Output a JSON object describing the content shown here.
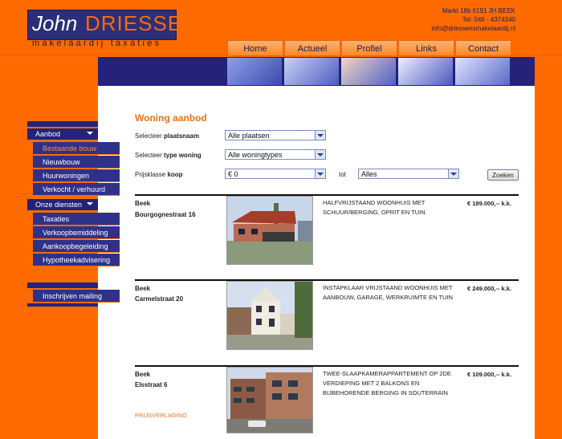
{
  "logo": {
    "first": "John",
    "last": "DRIESSENS",
    "tagline": "makelaardij taxaties"
  },
  "contact": {
    "address": "Markt 16b 6191 JH BEEK",
    "phone": "Tel: 046 - 4374340",
    "email": "info@driessensmakelaardij.nl"
  },
  "nav": [
    "Home",
    "Actueel",
    "Profiel",
    "Links",
    "Contact"
  ],
  "sidebar": {
    "aanbod": "Aanbod",
    "aanbod_items": [
      "Bestaande bouw",
      "Nieuwbouw",
      "Huurwoningen",
      "Verkocht / verhuurd"
    ],
    "diensten": "Onze diensten",
    "diensten_items": [
      "Taxaties",
      "Verkoopbemiddeling",
      "Aankoopbegeleiding",
      "Hypotheekadvisering"
    ],
    "mailing": "Inschrijven mailing"
  },
  "form": {
    "title": "Woning aanbod",
    "place_label_pre": "Selecteer ",
    "place_label_bold": "plaatsnaam",
    "place_value": "Alle plaatsen",
    "type_label_pre": "Selecteer ",
    "type_label_bold": "type woning",
    "type_value": "Alle woningtypes",
    "price_label_pre": "Prijsklasse ",
    "price_label_bold": "koop",
    "price_from": "€ 0",
    "tot": "tot",
    "price_to": "Alles",
    "search": "Zoeken"
  },
  "listings": [
    {
      "city": "Beek",
      "street": "Bourgognestraat 16",
      "desc": "HALFVRIJSTAAND WOONHUIS MET SCHUUR/BERGING, OPRIT EN TUIN",
      "price": "€ 189.000,-- k.k."
    },
    {
      "city": "Beek",
      "street": "Carmelstraat 20",
      "desc": "INSTAPKLAAR VRIJSTAAND WOONHUIS MET AANBOUW, GARAGE, WERKRUIMTE EN TUIN",
      "price": "€ 249.000,-- k.k."
    },
    {
      "city": "Beek",
      "street": "Elsstraat 6",
      "desc": "TWEE-SLAAPKAMERAPPARTEMENT OP 2DE VERDIEPING MET 2 BALKONS EN BIJBEHORENDE BERGING IN SOUTERRAIN",
      "price": "€ 109.000,-- k.k.",
      "promo": "PRIJSVERLAGING"
    }
  ]
}
